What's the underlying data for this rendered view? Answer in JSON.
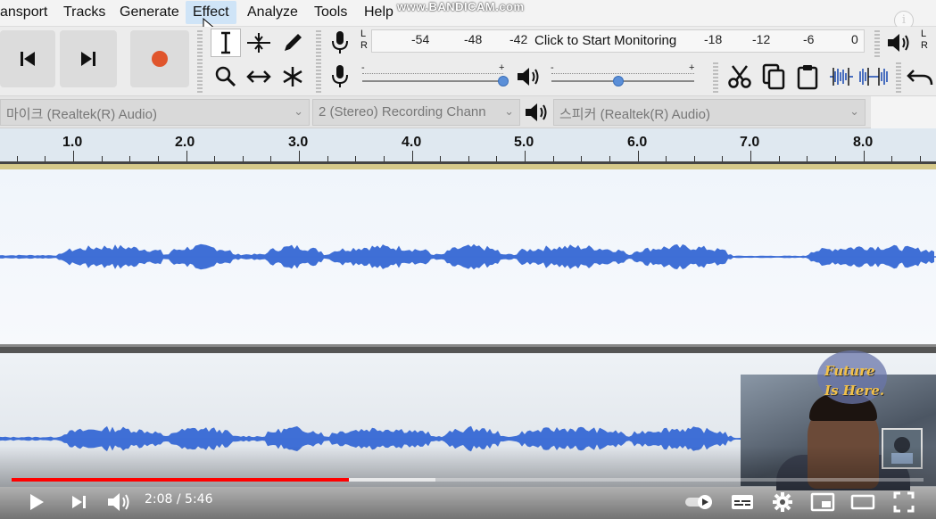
{
  "menu": {
    "items": [
      {
        "label": "ansport",
        "active": false
      },
      {
        "label": "Tracks",
        "active": false
      },
      {
        "label": "Generate",
        "active": false
      },
      {
        "label": "Effect",
        "active": true
      },
      {
        "label": "Analyze",
        "active": false
      },
      {
        "label": "Tools",
        "active": false
      },
      {
        "label": "Help",
        "active": false
      }
    ],
    "watermark": "www.BANDICAM.com"
  },
  "toolbar": {
    "transport": [
      "skip-to-start-icon",
      "skip-to-end-icon",
      "record-icon"
    ],
    "record_color": "#e0552c",
    "tools": [
      "selection-tool-icon",
      "envelope-tool-icon",
      "draw-tool-icon",
      "zoom-tool-icon",
      "time-shift-tool-icon",
      "multi-tool-icon"
    ],
    "meter": {
      "lr_top": "L",
      "lr_bottom": "R",
      "ticks_left": [
        "-54",
        "-48",
        "-42"
      ],
      "monitor_text": "Click to Start Monitoring",
      "ticks_right": [
        "-18",
        "-12",
        "-6",
        "0"
      ]
    },
    "mixer": {
      "mic_minus": "-",
      "mic_plus": "+",
      "mic_level": 1.0,
      "play_minus": "-",
      "play_plus": "+",
      "play_level": 0.47
    },
    "edit": [
      "cut-icon",
      "copy-icon",
      "paste-icon",
      "trim-icon",
      "silence-icon",
      "undo-icon"
    ],
    "playback_meter_lr_top": "L",
    "playback_meter_lr_bottom": "R"
  },
  "devices": {
    "recording_device": "마이크 (Realtek(R) Audio)",
    "channels": "2 (Stereo) Recording Chann",
    "playback_device": "스피커 (Realtek(R) Audio)"
  },
  "ruler": {
    "labels": [
      "1.0",
      "2.0",
      "3.0",
      "4.0",
      "5.0",
      "6.0",
      "7.0",
      "8.0"
    ]
  },
  "waveform_color": "#3f6fd6",
  "webcam": {
    "badge_line1": "Future",
    "badge_line2": "Is Here."
  },
  "player": {
    "current_time": "2:08",
    "separator": "/",
    "duration": "5:46",
    "time_display": "2:08 / 5:46",
    "played_fraction": 0.37,
    "buffered_fraction": 0.465,
    "progress_color": "#ff0000",
    "controls": [
      "play-icon",
      "next-icon",
      "volume-icon",
      "autoplay-toggle-icon",
      "subtitles-icon",
      "settings-icon",
      "miniplayer-icon",
      "theater-icon",
      "fullscreen-icon"
    ]
  }
}
